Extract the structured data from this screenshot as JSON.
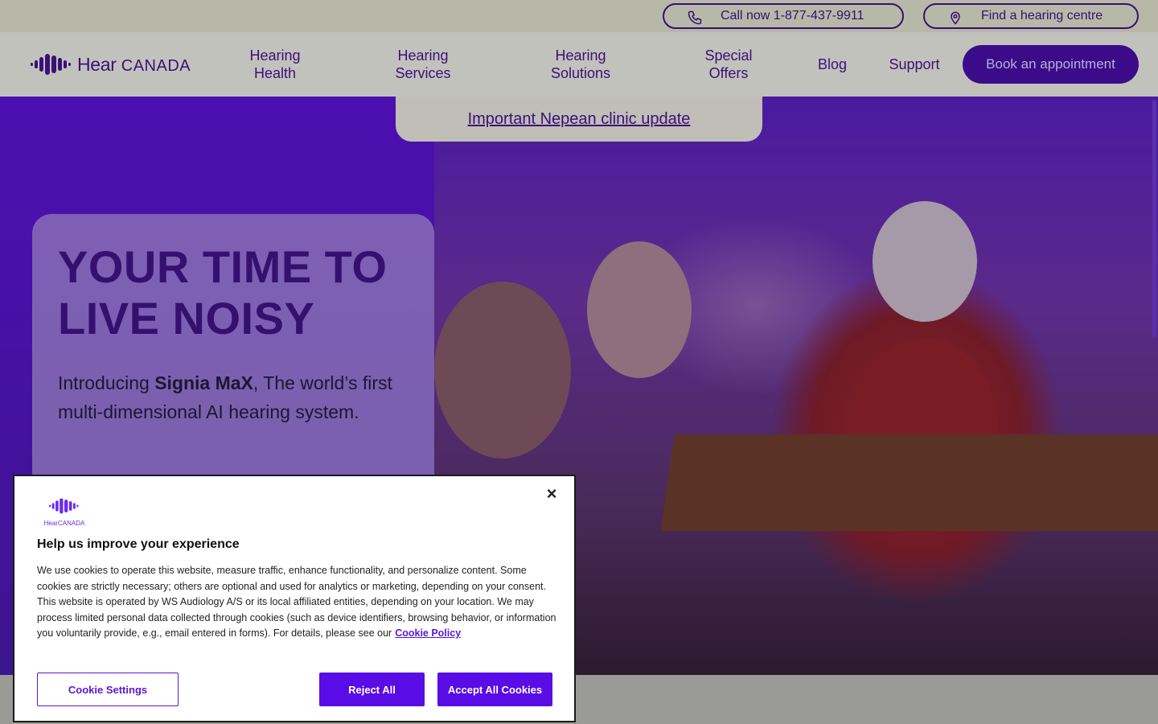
{
  "utility": {
    "call_label": "Call now 1-877-437-9911",
    "find_label": "Find a hearing centre"
  },
  "brand": {
    "name_part1": "Hear",
    "name_part2": "CANADA"
  },
  "nav": {
    "items": [
      {
        "line1": "Hearing",
        "line2": "Health"
      },
      {
        "line1": "Hearing",
        "line2": "Services"
      },
      {
        "line1": "Hearing",
        "line2": "Solutions"
      },
      {
        "line1": "Special",
        "line2": "Offers"
      },
      {
        "line1": "Blog",
        "line2": ""
      },
      {
        "line1": "Support",
        "line2": ""
      }
    ],
    "book_label": "Book an appointment"
  },
  "banner": {
    "link_text": "Important Nepean clinic update"
  },
  "hero": {
    "title_line1": "YOUR TIME TO",
    "title_line2": "LIVE NOISY",
    "sub_prefix": "Introducing ",
    "sub_bold": "Signia MaX",
    "sub_suffix": ", The world’s first multi-dimensional AI hearing system."
  },
  "cookie": {
    "logo_text": "HearCANADA",
    "close_glyph": "×",
    "heading": "Help us improve your experience",
    "body": "We use cookies to operate this website, measure traffic, enhance functionality, and personalize content. Some cookies are strictly necessary; others are optional and used for analytics or marketing, depending on your consent. This website is operated by WS Audiology A/S or its local affiliated entities, depending on your location. We may process limited personal data collected through cookies (such as device identifiers, browsing behavior, or information you voluntarily provide, e.g., email entered in forms). For details, please see our",
    "policy_link": "Cookie Policy",
    "settings_label": "Cookie Settings",
    "reject_label": "Reject All",
    "accept_label": "Accept All Cookies"
  },
  "colors": {
    "brand_purple": "#3a1177",
    "accent_purple": "#5a0ce6",
    "hero_purple": "#4c0fb0"
  },
  "icons": {
    "call": "phone-icon",
    "find": "location-pin-icon",
    "close": "close-icon"
  }
}
